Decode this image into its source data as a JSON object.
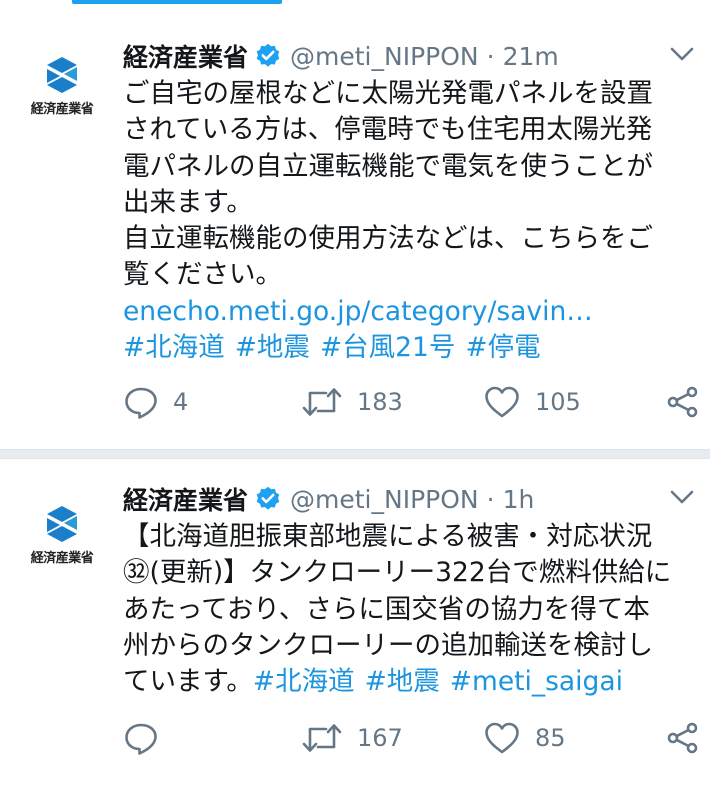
{
  "tweets": [
    {
      "avatar_caption": "経済産業省",
      "display_name": "経済産業省",
      "handle": "@meti_NIPPON",
      "separator": "·",
      "time": "21m",
      "text_lines": [
        "ご自宅の屋根などに太陽光発電パネルを設置",
        "されている方は、停電時でも住宅用太陽光発",
        "電パネルの自立運転機能で電気を使うことが",
        "出来ます。",
        "自立運転機能の使用方法などは、こちらをご",
        "覧ください。"
      ],
      "link": "enecho.meti.go.jp/category/savin…",
      "hashtags": [
        "#北海道",
        "#地震",
        "#台風21号",
        "#停電"
      ],
      "replies": "4",
      "retweets": "183",
      "likes": "105"
    },
    {
      "avatar_caption": "経済産業省",
      "display_name": "経済産業省",
      "handle": "@meti_NIPPON",
      "separator": "·",
      "time": "1h",
      "text_lines": [
        "【北海道胆振東部地震による被害・対応状況",
        "㉜(更新)】タンクローリー322台で燃料供給に",
        "あたっており、さらに国交省の協力を得て本",
        "州からのタンクローリーの追加輸送を検討し"
      ],
      "last_line_text": "ています。",
      "hashtags": [
        "#北海道",
        "#地震",
        "#meti_saigai"
      ],
      "replies": "",
      "retweets": "167",
      "likes": "85"
    }
  ],
  "icons": {
    "avatar_logo": "meti-logo-icon",
    "verified": "verified-badge-icon",
    "caret": "chevron-down-icon",
    "reply": "reply-icon",
    "retweet": "retweet-icon",
    "like": "heart-icon",
    "share": "share-icon"
  },
  "colors": {
    "accent": "#1da1f2",
    "link": "#1b95e0",
    "muted": "#657786",
    "logo_blue": "#1b7ecb"
  }
}
